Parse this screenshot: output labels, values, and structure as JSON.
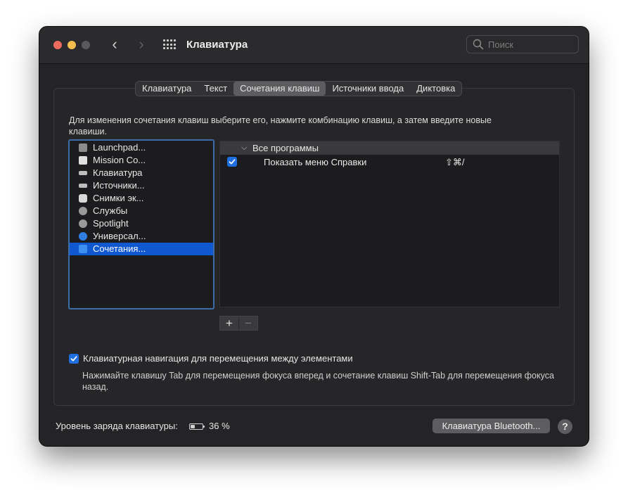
{
  "window": {
    "title": "Клавиатура",
    "search_placeholder": "Поиск"
  },
  "tabs": [
    {
      "label": "Клавиатура",
      "active": false
    },
    {
      "label": "Текст",
      "active": false
    },
    {
      "label": "Сочетания клавиш",
      "active": true
    },
    {
      "label": "Источники ввода",
      "active": false
    },
    {
      "label": "Диктовка",
      "active": false
    }
  ],
  "description": "Для изменения сочетания клавиш выберите его, нажмите комбинацию клавиш, а затем введите новые клавиши.",
  "categories": [
    {
      "label": "Launchpad...",
      "icon": "launchpad-icon",
      "color": "#8c8c8c"
    },
    {
      "label": "Mission Co...",
      "icon": "mission-control-icon",
      "color": "#e0e0e0"
    },
    {
      "label": "Клавиатура",
      "icon": "keyboard-icon",
      "color": "#bdbdbd"
    },
    {
      "label": "Источники...",
      "icon": "input-sources-icon",
      "color": "#bdbdbd"
    },
    {
      "label": "Снимки эк...",
      "icon": "screenshot-icon",
      "color": "#d9d9d9"
    },
    {
      "label": "Службы",
      "icon": "gear-icon",
      "color": "#9a9a9a"
    },
    {
      "label": "Spotlight",
      "icon": "spotlight-icon",
      "color": "#9a9a9a"
    },
    {
      "label": "Универсал...",
      "icon": "accessibility-icon",
      "color": "#2f7fe0"
    },
    {
      "label": "Сочетания...",
      "icon": "app-shortcuts-icon",
      "color": "#3d8ff0",
      "selected": true
    }
  ],
  "shortcuts": {
    "group_label": "Все программы",
    "rows": [
      {
        "checked": true,
        "name": "Показать меню Справки",
        "keys": "⇧⌘/"
      }
    ]
  },
  "buttons": {
    "add": "+",
    "remove": "−",
    "bluetooth": "Клавиатура Bluetooth...",
    "help": "?"
  },
  "keyboard_navigation": {
    "checked": true,
    "label": "Клавиатурная навигация для перемещения между элементами",
    "description": "Нажимайте клавишу Tab для перемещения фокуса вперед и сочетание клавиш Shift-Tab для перемещения фокуса назад."
  },
  "battery": {
    "label": "Уровень заряда клавиатуры:",
    "percent_text": "36 %",
    "level": 0.36
  },
  "colors": {
    "accent": "#1058d0",
    "checkbox": "#1f6fe0",
    "close": "#ed6a5e",
    "minimize": "#f5bf4f"
  }
}
